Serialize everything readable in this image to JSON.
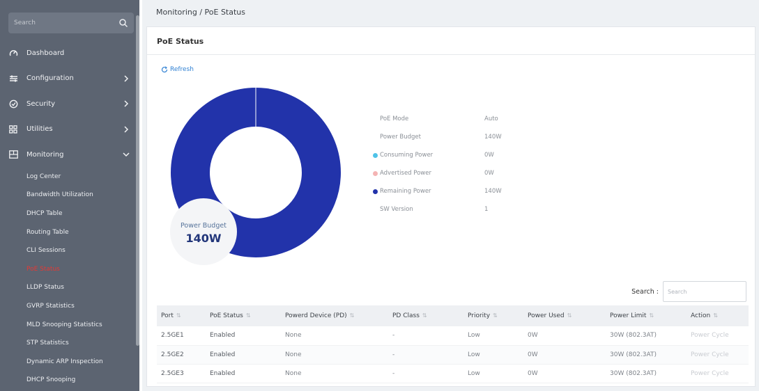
{
  "sidebar": {
    "search_placeholder": "Search",
    "items": [
      {
        "label": "Dashboard",
        "icon": "gauge-icon"
      },
      {
        "label": "Configuration",
        "icon": "sliders-icon"
      },
      {
        "label": "Security",
        "icon": "shield-icon"
      },
      {
        "label": "Utilities",
        "icon": "grid-icon"
      },
      {
        "label": "Monitoring",
        "icon": "monitor-icon"
      }
    ],
    "sub_items": [
      "Log Center",
      "Bandwidth Utilization",
      "DHCP Table",
      "Routing Table",
      "CLI Sessions",
      "PoE Status",
      "LLDP Status",
      "GVRP Statistics",
      "MLD Snooping Statistics",
      "STP Statistics",
      "Dynamic ARP Inspection",
      "DHCP Snooping"
    ],
    "active_sub": "PoE Status"
  },
  "breadcrumb": "Monitoring / PoE Status",
  "card_title": "PoE Status",
  "refresh_label": "Refresh",
  "donut": {
    "label": "Power Budget",
    "value": "140W",
    "color": "#2233aa"
  },
  "info": [
    {
      "key": "PoE Mode",
      "value": "Auto",
      "dot": ""
    },
    {
      "key": "Power Budget",
      "value": "140W",
      "dot": ""
    },
    {
      "key": "Consuming Power",
      "value": "0W",
      "dot": "#4fc3e8"
    },
    {
      "key": "Advertised Power",
      "value": "0W",
      "dot": "#f4b4b4"
    },
    {
      "key": "Remaining Power",
      "value": "140W",
      "dot": "#2233aa"
    },
    {
      "key": "SW Version",
      "value": "1",
      "dot": ""
    }
  ],
  "table": {
    "search_label": "Search :",
    "search_placeholder": "Search",
    "columns": [
      "Port",
      "PoE Status",
      "Powerd Device (PD)",
      "PD Class",
      "Priority",
      "Power Used",
      "Power Limit",
      "Action"
    ],
    "rows": [
      [
        "2.5GE1",
        "Enabled",
        "None",
        "-",
        "Low",
        "0W",
        "30W (802.3AT)",
        "Power Cycle"
      ],
      [
        "2.5GE2",
        "Enabled",
        "None",
        "-",
        "Low",
        "0W",
        "30W (802.3AT)",
        "Power Cycle"
      ],
      [
        "2.5GE3",
        "Enabled",
        "None",
        "-",
        "Low",
        "0W",
        "30W (802.3AT)",
        "Power Cycle"
      ]
    ]
  }
}
